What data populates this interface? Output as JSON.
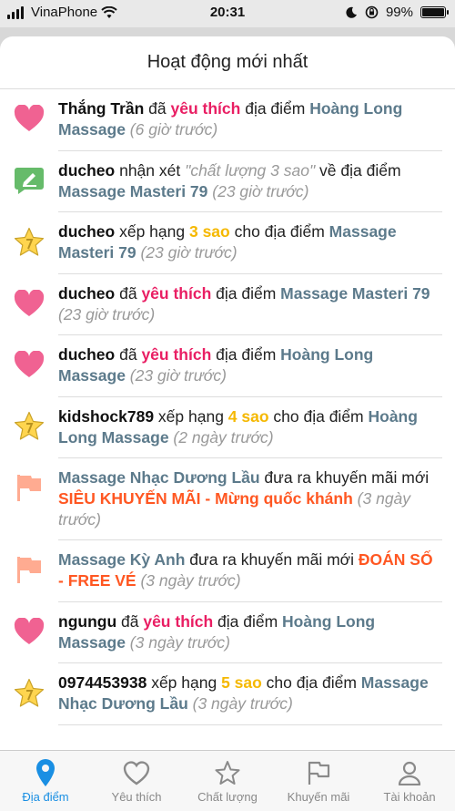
{
  "status": {
    "carrier": "VinaPhone",
    "time": "20:31",
    "battery": "99%",
    "battery_level": 0.99
  },
  "header": {
    "title": "Hoạt động mới nhất"
  },
  "feed": [
    {
      "icon": "heart-icon",
      "user": "Thắng Trần",
      "a": " đã ",
      "like": "yêu thích",
      "b": " địa điểm ",
      "place": "Hoàng Long Massage",
      "time": " (6 giờ trước)"
    },
    {
      "icon": "comment-icon",
      "user": "ducheo",
      "a": " nhận xét ",
      "quote": "\"chất lượng 3 sao\"",
      "b": " về địa điểm ",
      "place": "Massage Masteri 79",
      "time": " (23 giờ trước)"
    },
    {
      "icon": "star-icon",
      "user": "ducheo",
      "a": " xếp hạng ",
      "stars": "3 sao",
      "b": " cho địa điểm ",
      "place": "Massage Masteri 79",
      "time": " (23 giờ trước)"
    },
    {
      "icon": "heart-icon",
      "user": "ducheo",
      "a": " đã ",
      "like": "yêu thích",
      "b": " địa điểm ",
      "place": "Massage Masteri 79",
      "time": " (23 giờ trước)"
    },
    {
      "icon": "heart-icon",
      "user": "ducheo",
      "a": " đã ",
      "like": "yêu thích",
      "b": " địa điểm ",
      "place": "Hoàng Long Massage",
      "time": " (23 giờ trước)"
    },
    {
      "icon": "star-icon",
      "user": "kidshock789",
      "a": " xếp hạng ",
      "stars": "4 sao",
      "b": " cho địa điểm ",
      "place": "Hoàng Long Massage",
      "time": " (2 ngày trước)"
    },
    {
      "icon": "flag-icon",
      "place": "Massage Nhạc Dương Lầu",
      "a": " đưa ra khuyến mãi mới ",
      "promo": "SIÊU KHUYẾN MÃI - Mừng quốc khánh",
      "time": " (3 ngày trước)"
    },
    {
      "icon": "flag-icon",
      "place": "Massage Kỳ Anh",
      "a": " đưa ra khuyến mãi mới ",
      "promo": "ĐOÁN SỐ - FREE VÉ",
      "time": " (3 ngày trước)"
    },
    {
      "icon": "heart-icon",
      "user": "ngungu",
      "a": " đã ",
      "like": "yêu thích",
      "b": " địa điểm ",
      "place": "Hoàng Long Massage",
      "time": " (3 ngày trước)"
    },
    {
      "icon": "star-icon",
      "user": "0974453938",
      "a": " xếp hạng ",
      "stars": "5 sao",
      "b": " cho địa điểm ",
      "place": "Massage Nhạc Dương Lầu",
      "time": " (3 ngày trước)"
    }
  ],
  "tabs": [
    {
      "label": "Địa điểm",
      "icon": "map-pin-icon",
      "active": true
    },
    {
      "label": "Yêu thích",
      "icon": "heart-outline-icon",
      "active": false
    },
    {
      "label": "Chất lượng",
      "icon": "star-outline-icon",
      "active": false
    },
    {
      "label": "Khuyến mãi",
      "icon": "flag-outline-icon",
      "active": false
    },
    {
      "label": "Tài khoản",
      "icon": "person-icon",
      "active": false
    }
  ],
  "colors": {
    "heart": "#f06292",
    "comment": "#66bb6a",
    "star": "#ffd54f",
    "flag": "#ffab91",
    "active_tab": "#1a8fe3"
  }
}
